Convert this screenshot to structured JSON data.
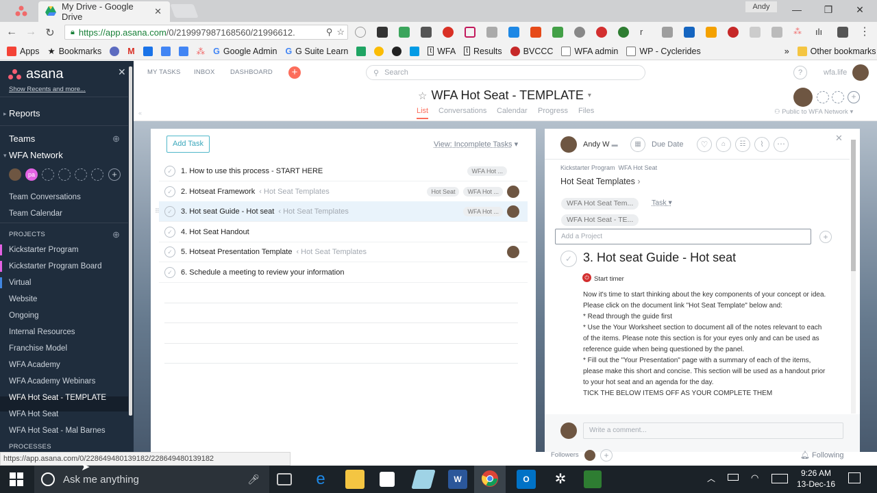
{
  "browser": {
    "tab_title": "My Drive - Google Drive",
    "user": "Andy",
    "url_host": "https://app.asana.com",
    "url_path": "/0/219997987168560/21996612.",
    "status_url": "https://app.asana.com/0/228649480139182/228649480139182"
  },
  "bookmarks": [
    {
      "label": "Apps",
      "icon": "apps-grid-icon",
      "color": "#f44336"
    },
    {
      "label": "Bookmarks",
      "icon": "star-icon",
      "color": "#444444"
    },
    {
      "label": "Google Admin",
      "icon": "google-g-icon",
      "color": "#4285f4"
    },
    {
      "label": "G Suite Learn",
      "icon": "google-g-icon",
      "color": "#4285f4"
    },
    {
      "label": "WFA",
      "icon": "t-icon",
      "color": "#333333"
    },
    {
      "label": "Results",
      "icon": "t-icon",
      "color": "#333333"
    },
    {
      "label": "BVCCC",
      "icon": "w-circle-icon",
      "color": "#c62828"
    },
    {
      "label": "WFA admin",
      "icon": "page-icon",
      "color": "#666666"
    },
    {
      "label": "WP - Cyclerides",
      "icon": "page-icon",
      "color": "#666666"
    },
    {
      "label": "Other bookmarks",
      "icon": "folder-icon",
      "color": "#f4c542"
    }
  ],
  "bookmarks_overflow": "»",
  "sidebar": {
    "logo": "asana",
    "show_recents": "Show Recents and more...",
    "reports": "Reports",
    "teams": "Teams",
    "team_name": "WFA Network",
    "member_initials": "pa",
    "team_conversations": "Team Conversations",
    "team_calendar": "Team Calendar",
    "projects_caption": "PROJECTS",
    "projects": [
      {
        "label": "Kickstarter Program",
        "color": "#e362e3"
      },
      {
        "label": "Kickstarter Program Board",
        "color": "#e362e3"
      },
      {
        "label": "Virtual",
        "color": "#4186e0"
      },
      {
        "label": "Website",
        "color": ""
      },
      {
        "label": "Ongoing",
        "color": ""
      },
      {
        "label": "Internal Resources",
        "color": ""
      },
      {
        "label": "Franchise Model",
        "color": ""
      },
      {
        "label": "WFA Academy",
        "color": ""
      },
      {
        "label": "WFA Academy Webinars",
        "color": ""
      },
      {
        "label": "WFA Hot Seat - TEMPLATE",
        "color": ""
      },
      {
        "label": "WFA Hot Seat",
        "color": ""
      },
      {
        "label": "WFA Hot Seat - Mal Barnes",
        "color": ""
      }
    ],
    "processes_caption": "PROCESSES"
  },
  "topnav": {
    "my_tasks": "MY TASKS",
    "inbox": "INBOX",
    "dashboard": "DASHBOARD",
    "search_placeholder": "Search",
    "org": "wfa.life"
  },
  "project": {
    "title": "WFA Hot Seat - TEMPLATE",
    "tabs": [
      "List",
      "Conversations",
      "Calendar",
      "Progress",
      "Files"
    ],
    "privacy": "Public to WFA Network"
  },
  "tasklist": {
    "add_task": "Add Task",
    "view": "View: Incomplete Tasks",
    "rows": [
      {
        "name": "1. How to use this process - START HERE",
        "proj": "",
        "tags": [
          "WFA Hot ..."
        ],
        "avatar": false
      },
      {
        "name": "2. Hotseat Framework",
        "proj": "‹ Hot Seat Templates",
        "tags": [
          "Hot Seat",
          "WFA Hot ..."
        ],
        "avatar": true
      },
      {
        "name": "3. Hot seat Guide - Hot seat",
        "proj": "‹ Hot Seat Templates",
        "tags": [
          "WFA Hot ..."
        ],
        "avatar": true
      },
      {
        "name": "4. Hot Seat Handout",
        "proj": "",
        "tags": [],
        "avatar": false
      },
      {
        "name": "5. Hotseat Presentation Template",
        "proj": "‹ Hot Seat Templates",
        "tags": [],
        "avatar": true
      },
      {
        "name": "6. Schedule a meeting to review your information",
        "proj": "",
        "tags": [],
        "avatar": false
      }
    ]
  },
  "detail": {
    "assignee": "Andy W",
    "due_date": "Due Date",
    "breadcrumb_1": "Kickstarter Program",
    "breadcrumb_2": "WFA Hot Seat",
    "parent": "Hot Seat Templates",
    "pill_1": "WFA Hot Seat Tem...",
    "pill_1_section": "Task",
    "pill_2": "WFA Hot Seat - TE...",
    "add_project_placeholder": "Add a Project",
    "task_title": "3. Hot seat Guide - Hot seat",
    "start_timer": "Start timer",
    "description": [
      "Now it's time to start thinking about the key components of your concept or idea. Please click on the document link \"Hot Seat Template\" below and:",
      "* Read through the guide first",
      "* Use the Your Worksheet section to document all of the notes relevant to each of the items. Please note this section is for your eyes only and can be used as reference guide when being questioned by the panel.",
      "* Fill out the \"Your Presentation\" page with a summary of each of the items, please make this short and concise. This section will be used as a handout prior to your hot seat and an agenda for the day.",
      "TICK THE BELOW ITEMS OFF AS YOUR COMPLETE THEM"
    ],
    "comment_placeholder": "Write a comment...",
    "followers": "Followers",
    "following": "Following"
  },
  "taskbar": {
    "cortana": "Ask me anything",
    "time": "9:26 AM",
    "date": "13-Dec-16"
  }
}
